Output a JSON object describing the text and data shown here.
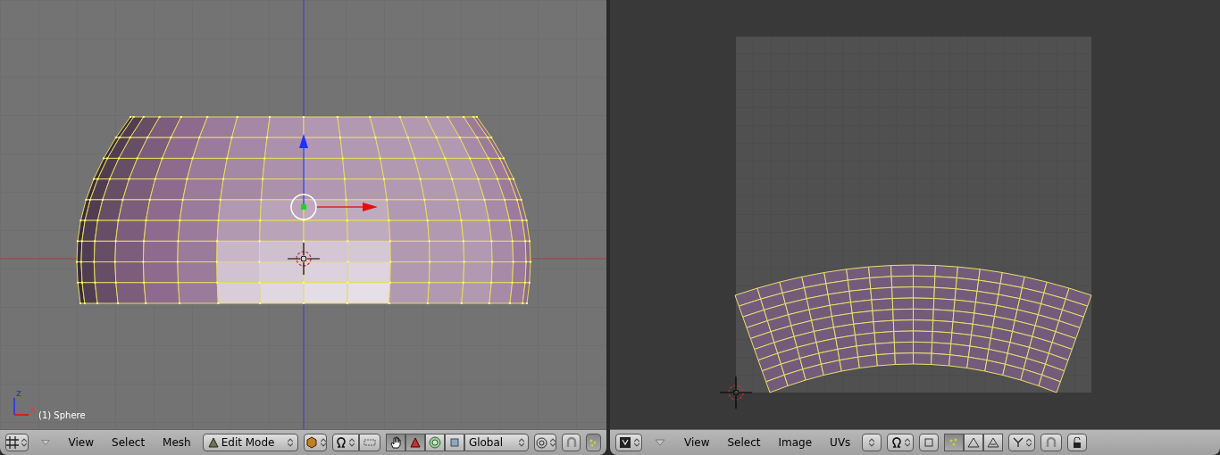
{
  "left_view": {
    "object_label": "(1) Sphere",
    "axis_labels": [
      "z",
      "x"
    ],
    "header": {
      "menus": [
        "View",
        "Select",
        "Mesh"
      ],
      "mode": "Edit Mode",
      "orientation": "Global",
      "manipulators": [
        {
          "kind": "hand",
          "selected": true
        },
        {
          "kind": "translate",
          "selected": true
        },
        {
          "kind": "rotate",
          "selected": false
        },
        {
          "kind": "scale",
          "selected": false
        }
      ]
    }
  },
  "right_view": {
    "header": {
      "menus": [
        "View",
        "Select",
        "Image",
        "UVs"
      ],
      "select_modes": [
        {
          "kind": "vertex",
          "selected": true
        },
        {
          "kind": "edge",
          "selected": false
        },
        {
          "kind": "face",
          "selected": false
        }
      ]
    }
  }
}
